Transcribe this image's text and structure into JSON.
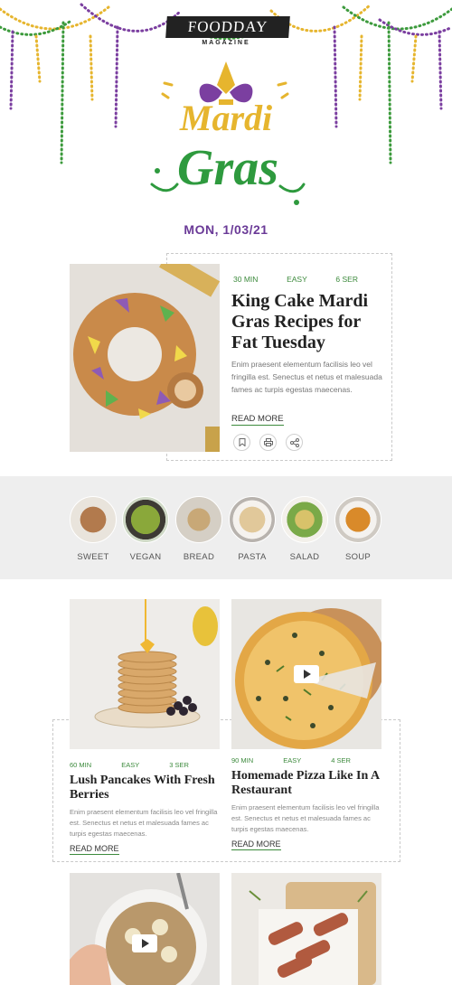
{
  "brand": {
    "name": "FOODDAY",
    "sub": "MAGAZINE"
  },
  "logo": {
    "line1": "Mardi",
    "line2": "Gras"
  },
  "date": "MON, 1/03/21",
  "colors": {
    "accent_green": "#3c8a3c",
    "accent_purple": "#6a3a97",
    "accent_gold": "#e8b830"
  },
  "feature": {
    "meta": {
      "time": "30 MIN",
      "level": "EASY",
      "servings": "6 SER"
    },
    "title": "King Cake Mardi Gras Recipes for Fat Tuesday",
    "desc": "Enim praesent elementum facilisis leo vel fringilla est. Senectus et netus et malesuada fames ac turpis egestas maecenas.",
    "read_more": "READ MORE",
    "actions": [
      "bookmark-icon",
      "print-icon",
      "share-icon"
    ]
  },
  "categories": [
    {
      "label": "SWEET"
    },
    {
      "label": "VEGAN"
    },
    {
      "label": "BREAD"
    },
    {
      "label": "PASTA"
    },
    {
      "label": "SALAD"
    },
    {
      "label": "SOUP"
    }
  ],
  "cards": [
    {
      "meta": {
        "time": "60 MIN",
        "level": "EASY",
        "servings": "3 SER"
      },
      "title": "Lush Pancakes With Fresh Berries",
      "desc": "Enim praesent elementum facilisis leo vel fringilla est. Senectus et netus et malesuada fames ac turpis egestas maecenas.",
      "read_more": "READ MORE"
    },
    {
      "meta": {
        "time": "90 MIN",
        "level": "EASY",
        "servings": "4 SER"
      },
      "title": "Homemade Pizza Like In A Restaurant",
      "desc": "Enim praesent elementum facilisis leo vel fringilla est. Senectus et netus et malesuada fames ac turpis egestas maecenas.",
      "read_more": "READ MORE"
    }
  ]
}
